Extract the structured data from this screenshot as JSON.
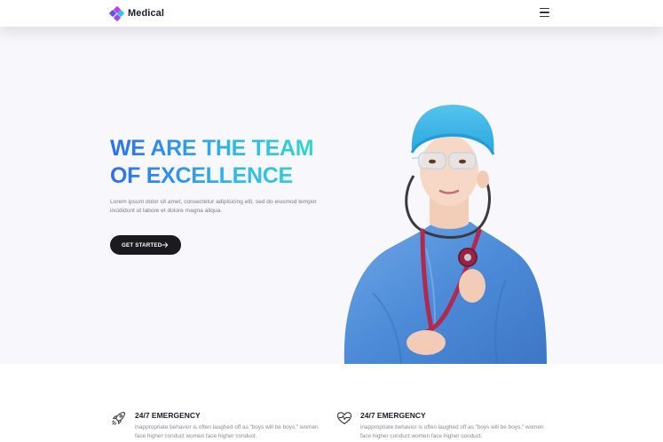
{
  "nav": {
    "brand": "Medical",
    "brand_colors": [
      "#c53dea",
      "#2fc3e8",
      "#6a4df0"
    ]
  },
  "hero": {
    "title_line1": "WE ARE THE TEAM",
    "title_line2": "OF EXCELLENCE",
    "text": "Lorem ipsum dolor sit amet, consectetur adipisicing elit, sed do eiusmod tempor incididunt ut labore et dolore magna aliqua.",
    "cta_label": "GET STARTED",
    "gradient": [
      "#2f6df0",
      "#31b9e6",
      "#36ddc4"
    ],
    "image": "nurse-with-stethoscope"
  },
  "features": [
    {
      "icon": "rocket-icon",
      "title": "24/7 EMERGENCY",
      "text": "inappropriate behavior is often laughed off as \"boys will be boys,\" women face higher conduct women face higher conduct."
    },
    {
      "icon": "heartbeat-icon",
      "title": "24/7 EMERGENCY",
      "text": "inappropriate behavior is often laughed off as \"boys will be boys,\" women face higher conduct women face higher conduct."
    }
  ]
}
